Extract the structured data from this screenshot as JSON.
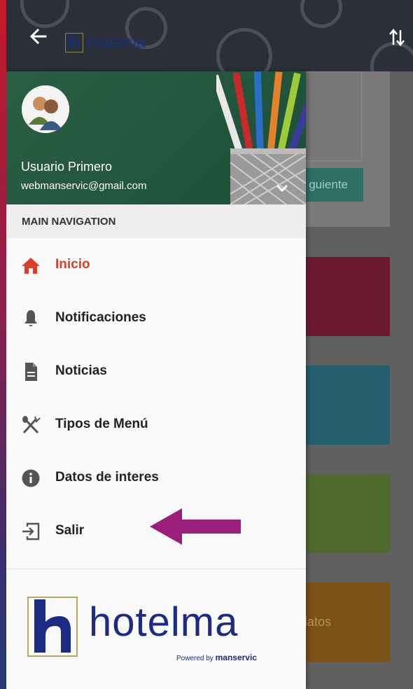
{
  "app_bar": {
    "logo_text": "hotelma",
    "back_icon": "arrow-left-icon",
    "sort_icon": "swap-vert-icon"
  },
  "drawer": {
    "user_name": "Usuario Primero",
    "user_email": "webmanservic@gmail.com",
    "section_title": "MAIN NAVIGATION",
    "items": [
      {
        "label": "Inicio",
        "icon": "home-icon",
        "active": true
      },
      {
        "label": "Notificaciones",
        "icon": "bell-icon",
        "active": false
      },
      {
        "label": "Noticias",
        "icon": "document-icon",
        "active": false
      },
      {
        "label": "Tipos de Menú",
        "icon": "fork-spoon-icon",
        "active": false
      },
      {
        "label": "Datos de interes",
        "icon": "info-icon",
        "active": false
      },
      {
        "label": "Salir",
        "icon": "exit-icon",
        "active": false
      }
    ],
    "footer_logo_text": "hotelma",
    "footer_powered_prefix": "Powered by",
    "footer_powered_brand": "manservic"
  },
  "background_app": {
    "next_button_label": "guiente",
    "card_text": "ros datos"
  },
  "colors": {
    "active": "#d9402a",
    "annotation_arrow": "#9b1f7a",
    "appbar": "#2a2f38"
  }
}
